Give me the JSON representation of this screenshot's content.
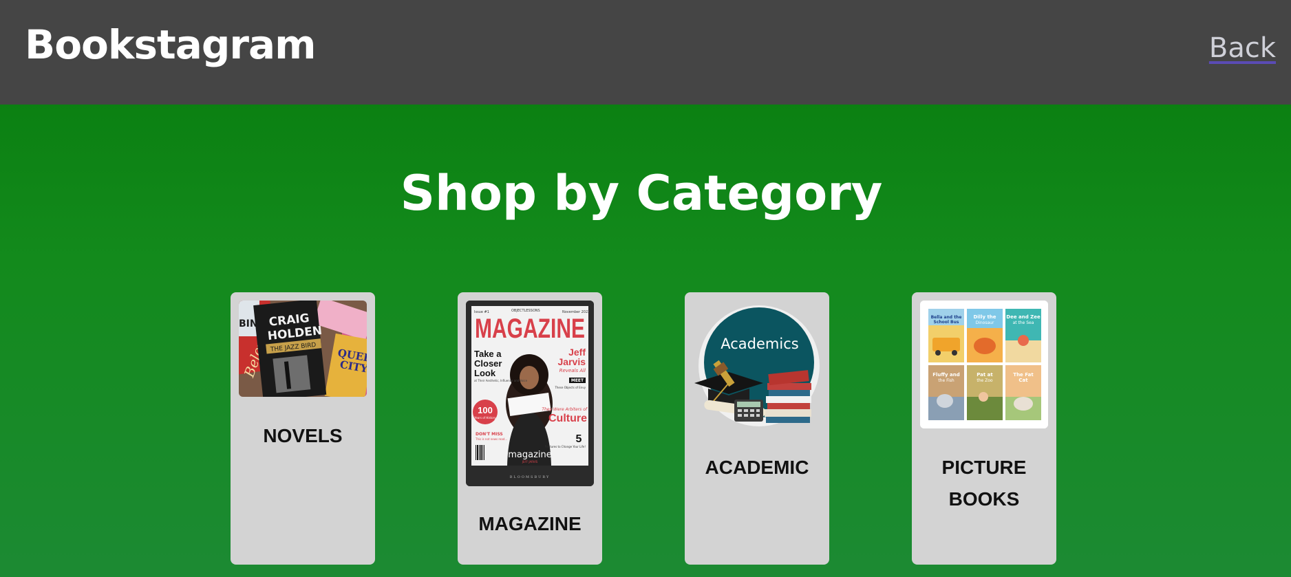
{
  "header": {
    "brand": "Bookstagram",
    "back_label": "Back"
  },
  "main": {
    "title": "Shop by Category",
    "categories": [
      {
        "label": "NOVELS",
        "image_text": [
          "CRAIG",
          "HOLDEN",
          "THE JAZZ BIRD",
          "Beloved",
          "QUEEN",
          "CITY",
          "BIN"
        ]
      },
      {
        "label": "MAGAZINE",
        "image_text": {
          "issue": "Issue #1",
          "series": "OBJECTLESSONS",
          "date": "November 2022",
          "masthead": "MAGAZINE",
          "headline": "Take a Closer Look",
          "subline": "at Their Aesthetic, Influence and Voice",
          "author": "Jeff Jarvis",
          "author_tag": "Reveals All",
          "meet": "MEET",
          "meet_sub": "These Objects of Envy",
          "badge_num": "100",
          "badge_text": "Years of History",
          "arbiters": "They Were Arbiters of",
          "culture": "Culture",
          "dont_miss": "DON'T MISS",
          "dont_miss_sub": "This is not news read...",
          "features_num": "5",
          "features_text": "Features to Change Your Life!",
          "footer_title": "magazine",
          "footer_author": "JEFF JARVIS",
          "publisher": "BLOOMSBURY"
        }
      },
      {
        "label": "ACADEMIC",
        "image_text": "Academics"
      },
      {
        "label": "PICTURE BOOKS",
        "label_lines": [
          "PICTURE",
          "BOOKS"
        ],
        "image_text": [
          "Bella and the School Bus",
          "Dilly the Dinosaur",
          "Dee and Zee at the Sea",
          "Fluffy and the Fish",
          "Pat at the Zoo",
          "The Fat Cat"
        ]
      }
    ]
  },
  "colors": {
    "header_bg": "#454545",
    "page_bg_top": "#067a0b",
    "page_bg_bottom": "#1c8a33",
    "card_bg": "#d3d3d3",
    "link": "#cfd0d8"
  }
}
